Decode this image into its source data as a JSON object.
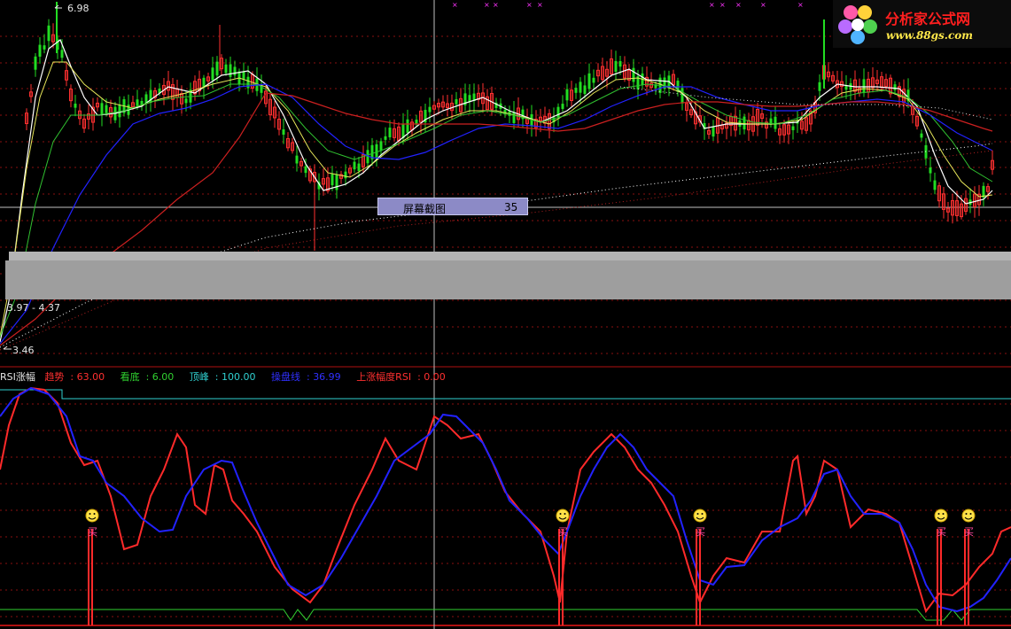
{
  "logo": {
    "title": "分析家公式网",
    "url": "www.88gs.com"
  },
  "main_panel": {
    "price_high_label": "6.98",
    "price_low_label": "3.46",
    "range_label": "3.97 - 4.37",
    "tooltip_label": "屏幕截图",
    "tooltip_value": "35"
  },
  "indicator_panel": {
    "name": "RSI涨幅",
    "fields": [
      {
        "label": "趋势",
        "value": "63.00",
        "color": "#ff3030"
      },
      {
        "label": "看底",
        "value": "6.00",
        "color": "#30d030"
      },
      {
        "label": "顶峰",
        "value": "100.00",
        "color": "#30d0d0"
      },
      {
        "label": "操盘线",
        "value": "36.99",
        "color": "#3030ff"
      },
      {
        "label": "上涨幅度RSI",
        "value": "0.00",
        "color": "#ff3030"
      }
    ],
    "buy_signal_label": "买",
    "buy_signal_count": 5
  },
  "colors": {
    "background": "#000000",
    "grid": "#8a1010",
    "up_candle": "#ff3030",
    "down_candle": "#22dd22",
    "ma_white": "#ffffff",
    "ma_yellow": "#e8e85a",
    "ma_green": "#30c030",
    "ma_blue": "#2222ff",
    "ma_red": "#cc2020",
    "signal_magenta": "#ff33ff"
  }
}
